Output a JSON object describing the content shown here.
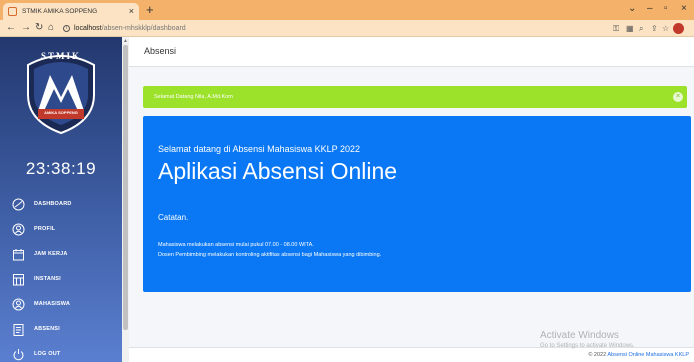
{
  "browser": {
    "tab_title": "STMIK AMIKA SOPPENG",
    "tab_close": "×",
    "new_tab": "+",
    "url_host": "localhost",
    "url_path": "/absen-mhskklp/dashboard"
  },
  "sidebar": {
    "logo_text": "STMIK",
    "logo_subtext": "AMIKA SOPPENG",
    "clock": "23:38:19",
    "items": [
      {
        "label": "DASHBOARD",
        "icon": "dashboard-icon"
      },
      {
        "label": "PROFIL",
        "icon": "user-icon"
      },
      {
        "label": "JAM KERJA",
        "icon": "calendar-icon"
      },
      {
        "label": "INSTANSI",
        "icon": "building-icon"
      },
      {
        "label": "MAHASISWA",
        "icon": "users-icon"
      },
      {
        "label": "ABSENSI",
        "icon": "clipboard-icon"
      },
      {
        "label": "LOG OUT",
        "icon": "power-icon"
      }
    ]
  },
  "main": {
    "page_title": "Absensi",
    "alert": {
      "text": "Selamat Datang Nila, A.Md.Kom",
      "close": "×"
    },
    "card": {
      "subtitle": "Selamat datang di Absensi Mahasiswa KKLP 2022",
      "title": "Aplikasi Absensi Online",
      "notes_label": "Catatan.",
      "line1": "Mahasiswa melakukan absensi mulai pukul 07.00 - 08.00 WITA.",
      "line2": "Dosen Pembimbing melakukan kontroling aktifitas absensi bagi Mahasiswa yang dibimbing."
    },
    "footer_prefix": "© 2022 ",
    "footer_link": "Absensi Online Mahasiswa KKLP"
  },
  "watermark": {
    "line1": "Activate Windows",
    "line2": "Go to Settings to activate Windows."
  },
  "colors": {
    "sidebar_top": "#23386e",
    "sidebar_bottom": "#5b7fd0",
    "alert_green": "#9ce12a",
    "card_blue": "#0a78f5",
    "chrome_orange": "#f3b169"
  }
}
